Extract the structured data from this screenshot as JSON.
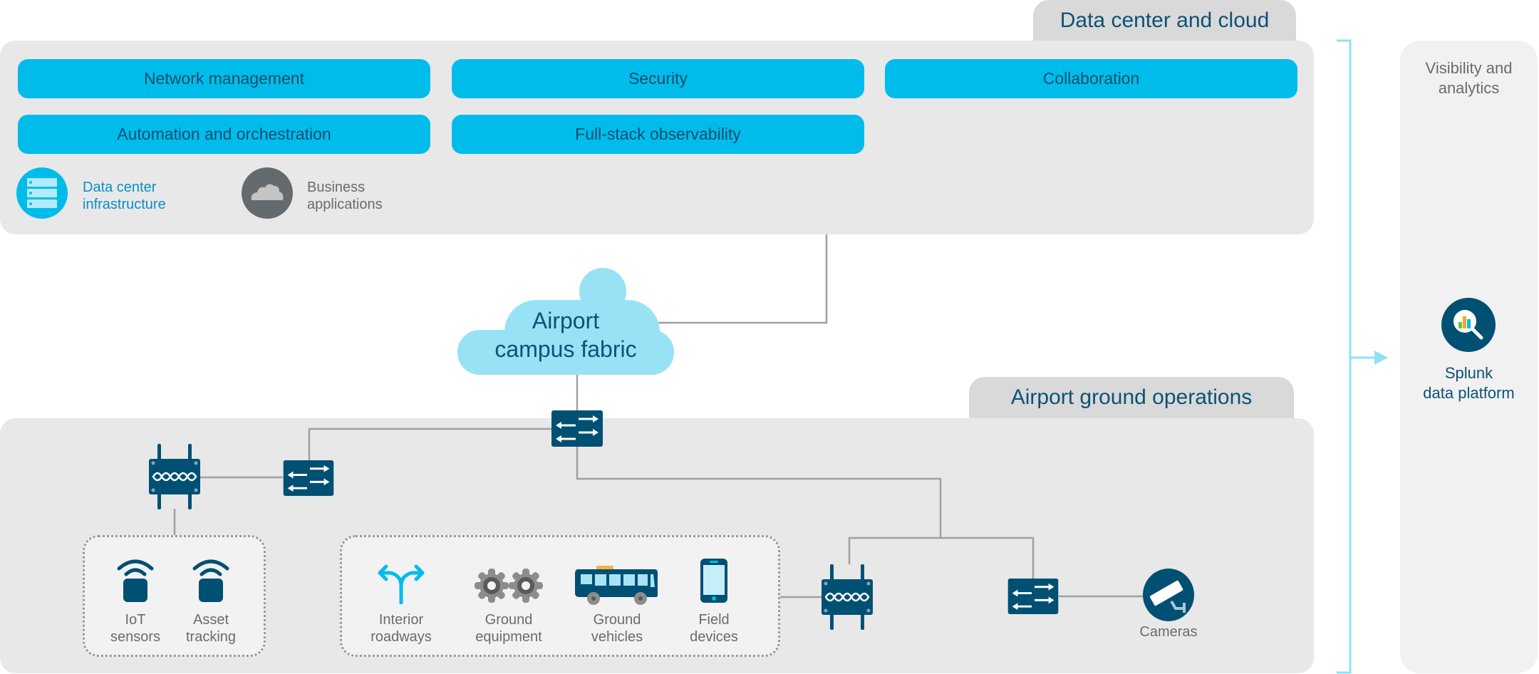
{
  "colors": {
    "accent": "#00bceb",
    "dark_blue": "#005073",
    "title_text": "#0d5275",
    "panel_bg": "#e8e8e8",
    "tab_bg": "#d9d9d9",
    "cloud": "#97e3f5",
    "connector": "#a0a0a0",
    "bracket": "#8ee2f7"
  },
  "data_center": {
    "tab_label": "Data center and cloud",
    "capabilities": [
      {
        "label": "Network management"
      },
      {
        "label": "Security"
      },
      {
        "label": "Collaboration"
      },
      {
        "label": "Automation and orchestration"
      },
      {
        "label": "Full-stack observability"
      }
    ],
    "infrastructure": {
      "label_line1": "Data center",
      "label_line2": "infrastructure",
      "icon": "server-stack-icon"
    },
    "business_apps": {
      "label_line1": "Business",
      "label_line2": "applications",
      "icon": "cloud-icon"
    }
  },
  "campus_fabric": {
    "line1": "Airport",
    "line2": "campus fabric"
  },
  "ground_ops": {
    "tab_label": "Airport ground operations",
    "iot_group": [
      {
        "line1": "IoT",
        "line2": "sensors",
        "icon": "wireless-sensor-icon"
      },
      {
        "line1": "Asset",
        "line2": "tracking",
        "icon": "wireless-sensor-icon"
      }
    ],
    "device_group": [
      {
        "line1": "Interior",
        "line2": "roadways",
        "icon": "road-fork-icon"
      },
      {
        "line1": "Ground",
        "line2": "equipment",
        "icon": "gears-icon"
      },
      {
        "line1": "Ground",
        "line2": "vehicles",
        "icon": "bus-icon"
      },
      {
        "line1": "Field",
        "line2": "devices",
        "icon": "smartphone-icon"
      }
    ],
    "cameras": {
      "label": "Cameras",
      "icon": "security-camera-icon"
    }
  },
  "visibility": {
    "title_line1": "Visibility and",
    "title_line2": "analytics",
    "platform_line1": "Splunk",
    "platform_line2": "data platform",
    "icon": "magnifier-chart-icon"
  }
}
